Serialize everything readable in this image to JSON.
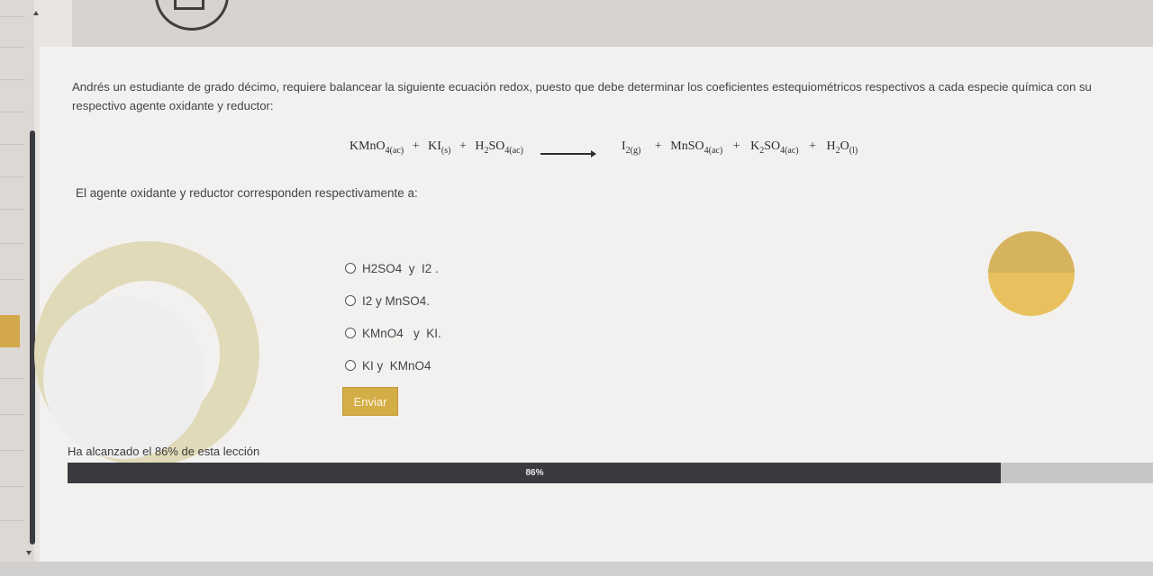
{
  "question": {
    "text": "Andrés un estudiante de grado décimo, requiere balancear la siguiente ecuación redox, puesto que debe determinar los coeficientes estequiométricos respectivos a cada especie química con su respectivo agente oxidante y reductor:"
  },
  "equation": {
    "reactants": [
      {
        "formula": "KMnO",
        "sub": "4(ac)"
      },
      {
        "formula": "KI",
        "sub": "(s)"
      },
      {
        "formula": "H",
        "sub": "2",
        "formula2": "SO",
        "sub2": "4(ac)"
      }
    ],
    "products": [
      {
        "formula": "I",
        "sub": "2(g)"
      },
      {
        "formula": "MnSO",
        "sub": "4(ac)"
      },
      {
        "formula": "K",
        "sub": "2",
        "formula2": "SO",
        "sub2": "4(ac)"
      },
      {
        "formula": "H",
        "sub": "2",
        "formula2": "O",
        "sub2": "(l)"
      }
    ],
    "plus": "+"
  },
  "prompt": "El agente oxidante y reductor corresponden respectivamente a:",
  "options": [
    "H2SO4  y  I2 .",
    "I2 y MnSO4.",
    "KMnO4   y  KI.",
    "KI y  KMnO4"
  ],
  "submit_label": "Enviar",
  "progress": {
    "text": "Ha alcanzado el 86% de esta lección",
    "label": "86%",
    "fraction": 0.86
  },
  "colors": {
    "accent": "#d3ad46",
    "progress_fill": "#393b40",
    "progress_track": "#c8c6c4"
  },
  "icons": [
    "cursor-icon",
    "scroll-up-icon",
    "scroll-down-icon"
  ]
}
